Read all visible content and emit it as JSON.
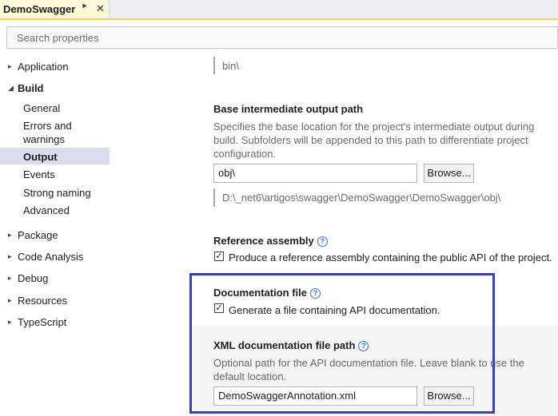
{
  "tab": {
    "title": "DemoSwagger",
    "pin_icon": "pin-icon",
    "close_icon": "close-icon"
  },
  "search": {
    "placeholder": "Search properties"
  },
  "sidebar": {
    "application": "Application",
    "build": "Build",
    "build_children": [
      "General",
      "Errors and warnings",
      "Output",
      "Events",
      "Strong naming",
      "Advanced"
    ],
    "selected": "Output",
    "package": "Package",
    "code_analysis": "Code Analysis",
    "debug": "Debug",
    "resources": "Resources",
    "typescript": "TypeScript"
  },
  "output_path": {
    "value": "bin\\"
  },
  "base_intermediate": {
    "label": "Base intermediate output path",
    "description": "Specifies the base location for the project's intermediate output during build. Subfolders will be appended to this path to differentiate project configuration.",
    "value": "obj\\",
    "browse": "Browse...",
    "resolved": "D:\\_net6\\artigos\\swagger\\DemoSwagger\\DemoSwagger\\obj\\"
  },
  "reference_assembly": {
    "label": "Reference assembly",
    "checkbox_label": "Produce a reference assembly containing the public API of the project.",
    "checked": true
  },
  "documentation_file": {
    "label": "Documentation file",
    "checkbox_label": "Generate a file containing API documentation.",
    "checked": true
  },
  "xml_doc_path": {
    "label": "XML documentation file path",
    "description": "Optional path for the API documentation file. Leave blank to use the default location.",
    "value": "DemoSwaggerAnnotation.xml",
    "browse": "Browse..."
  },
  "colors": {
    "accent_tab": "#f4d84a",
    "highlight_box": "#3b3fbf",
    "selection": "#dcdcef"
  }
}
